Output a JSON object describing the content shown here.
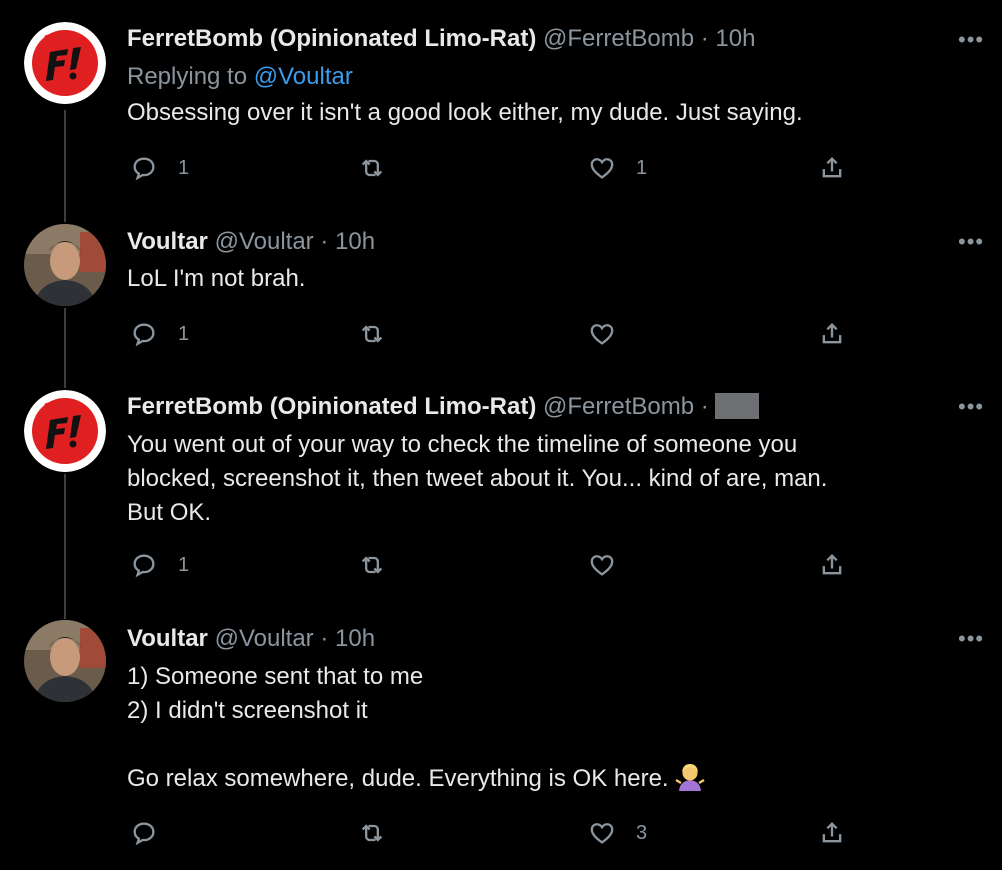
{
  "tweets": [
    {
      "name": "FerretBomb (Opinionated Limo-Rat)",
      "handle": "@FerretBomb",
      "dot": "·",
      "time": "10h",
      "replying_prefix": "Replying to ",
      "replying_to": "@Voultar",
      "body": "Obsessing over it isn't a good look either, my dude. Just saying.",
      "replies": "1",
      "retweets": "",
      "likes": "1"
    },
    {
      "name": "Voultar",
      "handle": "@Voultar",
      "dot": "·",
      "time": "10h",
      "body": "LoL I'm not brah.",
      "replies": "1",
      "retweets": "",
      "likes": ""
    },
    {
      "name": "FerretBomb (Opinionated Limo-Rat)",
      "handle": "@FerretBomb",
      "dot": "·",
      "time": "",
      "body": "You went out of your way to check the timeline of someone you\nblocked, screenshot it, then tweet about it. You... kind of are, man.\nBut OK.",
      "replies": "1",
      "retweets": "",
      "likes": ""
    },
    {
      "name": "Voultar",
      "handle": "@Voultar",
      "dot": "·",
      "time": "10h",
      "body": "1) Someone sent that to me\n2) I didn't screenshot it\n\nGo relax somewhere, dude. Everything is OK here.",
      "replies": "",
      "retweets": "",
      "likes": "3"
    }
  ],
  "icons": {
    "more": "more-icon",
    "reply": "reply-icon",
    "retweet": "retweet-icon",
    "like": "heart-icon",
    "share": "share-icon",
    "emoji": "person-shrugging-emoji"
  },
  "colors": {
    "background": "#000000",
    "text": "#e7e9ea",
    "secondary": "#8b959e",
    "link": "#3a9cea",
    "logo_red": "#e02020"
  }
}
